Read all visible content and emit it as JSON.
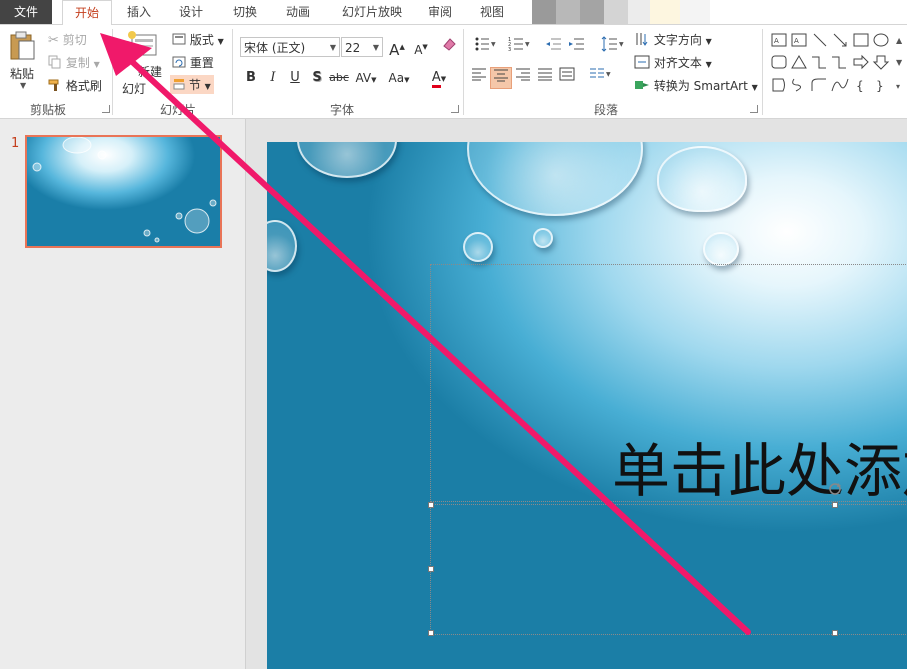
{
  "tabs": [
    {
      "label": "文件"
    },
    {
      "label": "开始"
    },
    {
      "label": "插入"
    },
    {
      "label": "设计"
    },
    {
      "label": "切换"
    },
    {
      "label": "动画"
    },
    {
      "label": "幻灯片放映"
    },
    {
      "label": "审阅"
    },
    {
      "label": "视图"
    }
  ],
  "clipboard": {
    "paste": "粘贴",
    "cut": "剪切",
    "copy": "复制",
    "format_painter": "格式刷",
    "group_label": "剪贴板"
  },
  "slides_group": {
    "new_slide_top": "新建",
    "new_slide_bottom": "幻灯",
    "layout": "版式",
    "reset": "重置",
    "section": "节",
    "group_label": "幻灯片"
  },
  "font_group": {
    "font_name": "宋体 (正文)",
    "font_size": "22",
    "group_label": "字体",
    "bold": "B",
    "italic": "I",
    "underline": "U",
    "shadow": "S",
    "strike": "abc",
    "spacing": "AV",
    "case": "Aa",
    "color": "A",
    "grow": "A",
    "shrink": "A"
  },
  "paragraph_group": {
    "text_direction": "文字方向",
    "align_text": "对齐文本",
    "smartart": "转换为 SmartArt",
    "group_label": "段落"
  },
  "slide_panel": {
    "slide_number": "1"
  },
  "slide": {
    "title_placeholder": "单击此处添加标题"
  },
  "colors": {
    "accent": "#c43e1c",
    "arrow": "#f0196a",
    "selected_thumb_border": "#e97457"
  }
}
